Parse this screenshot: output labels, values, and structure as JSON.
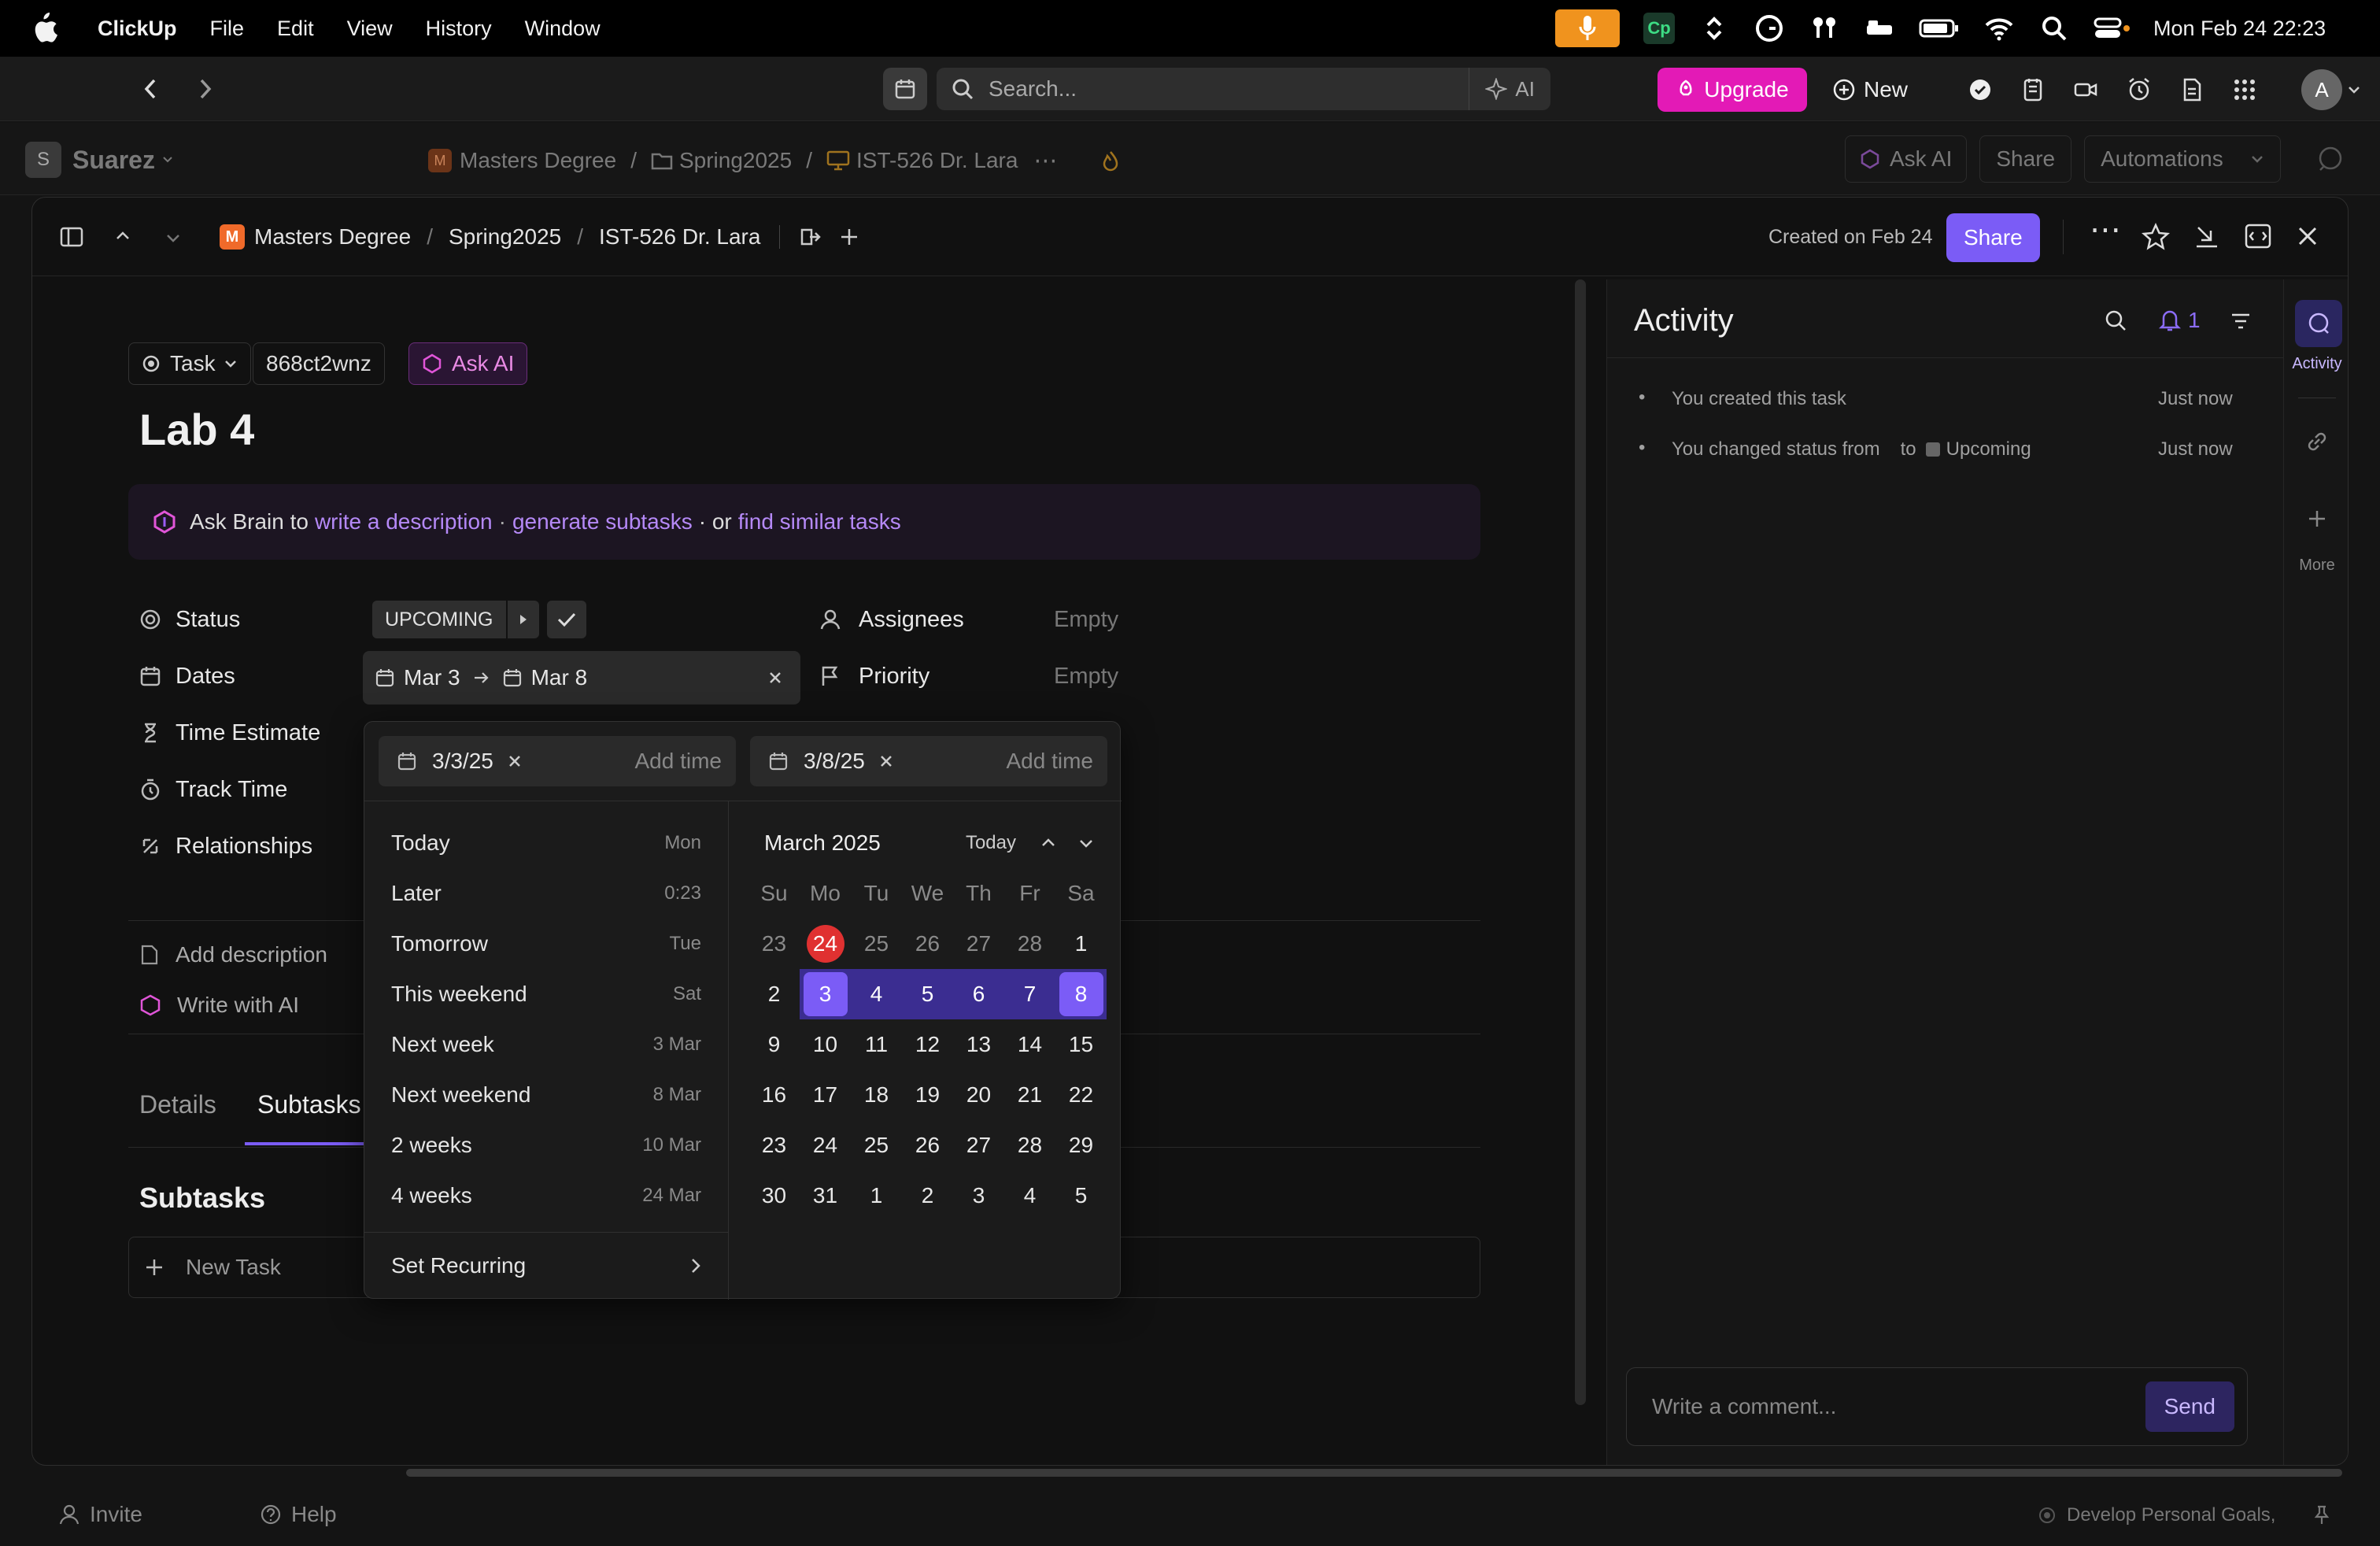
{
  "menubar": {
    "app": "ClickUp",
    "items": [
      "File",
      "Edit",
      "View",
      "History",
      "Window"
    ],
    "clock": "Mon Feb 24  22:23"
  },
  "toolbar": {
    "search_placeholder": "Search...",
    "ai_label": "AI",
    "upgrade_label": "Upgrade",
    "new_label": "New",
    "avatar": "A"
  },
  "workspace": {
    "name": "Suarez",
    "initial": "S",
    "breadcrumb": [
      "Masters Degree",
      "Spring2025",
      "IST-526 Dr. Lara"
    ],
    "ask_ai": "Ask AI",
    "share": "Share",
    "automations": "Automations"
  },
  "modal": {
    "breadcrumb": [
      "Masters Degree",
      "Spring2025",
      "IST-526 Dr. Lara"
    ],
    "space_initial": "M",
    "created": "Created on Feb 24",
    "share": "Share"
  },
  "task": {
    "type": "Task",
    "id": "868ct2wnz",
    "ask_ai": "Ask AI",
    "title": "Lab 4",
    "brain": {
      "prefix": "Ask Brain to",
      "link1": "write a description",
      "sep1": "·",
      "link2": "generate subtasks",
      "sep2": "· or",
      "link3": "find similar tasks"
    },
    "fields": {
      "status_label": "Status",
      "status_value": "UPCOMING",
      "dates_label": "Dates",
      "date_start": "Mar 3",
      "date_end": "Mar 8",
      "time_estimate_label": "Time Estimate",
      "track_time_label": "Track Time",
      "relationships_label": "Relationships",
      "assignees_label": "Assignees",
      "assignees_value": "Empty",
      "priority_label": "Priority",
      "priority_value": "Empty"
    },
    "add_description": "Add description",
    "write_with_ai": "Write with AI",
    "tabs": [
      "Details",
      "Subtasks"
    ],
    "subtasks_heading": "Subtasks",
    "new_task": "New Task"
  },
  "datepicker": {
    "start_date": "3/3/25",
    "end_date": "3/8/25",
    "add_time": "Add time",
    "presets": [
      {
        "label": "Today",
        "hint": "Mon"
      },
      {
        "label": "Later",
        "hint": "0:23"
      },
      {
        "label": "Tomorrow",
        "hint": "Tue"
      },
      {
        "label": "This weekend",
        "hint": "Sat"
      },
      {
        "label": "Next week",
        "hint": "3 Mar"
      },
      {
        "label": "Next weekend",
        "hint": "8 Mar"
      },
      {
        "label": "2 weeks",
        "hint": "10 Mar"
      },
      {
        "label": "4 weeks",
        "hint": "24 Mar"
      }
    ],
    "set_recurring": "Set Recurring",
    "month": "March 2025",
    "today_label": "Today",
    "weekdays": [
      "Su",
      "Mo",
      "Tu",
      "We",
      "Th",
      "Fr",
      "Sa"
    ],
    "weeks": [
      [
        "23",
        "24",
        "25",
        "26",
        "27",
        "28",
        "1"
      ],
      [
        "2",
        "3",
        "4",
        "5",
        "6",
        "7",
        "8"
      ],
      [
        "9",
        "10",
        "11",
        "12",
        "13",
        "14",
        "15"
      ],
      [
        "16",
        "17",
        "18",
        "19",
        "20",
        "21",
        "22"
      ],
      [
        "23",
        "24",
        "25",
        "26",
        "27",
        "28",
        "29"
      ],
      [
        "30",
        "31",
        "1",
        "2",
        "3",
        "4",
        "5"
      ]
    ]
  },
  "activity": {
    "title": "Activity",
    "bell_count": "1",
    "events": [
      {
        "text": "You created this task",
        "time": "Just now"
      },
      {
        "text": "You changed status from",
        "to": "to",
        "status": "Upcoming",
        "time": "Just now"
      }
    ],
    "comment_placeholder": "Write a comment...",
    "send": "Send",
    "rail_activity": "Activity",
    "rail_more": "More"
  },
  "bottom": {
    "invite": "Invite",
    "help": "Help",
    "goal": "Develop Personal Goals,"
  },
  "colors": {
    "accent": "#7b5cf6",
    "upgrade": "#e31ab6",
    "today": "#e03131",
    "range": "#3b2d91"
  }
}
